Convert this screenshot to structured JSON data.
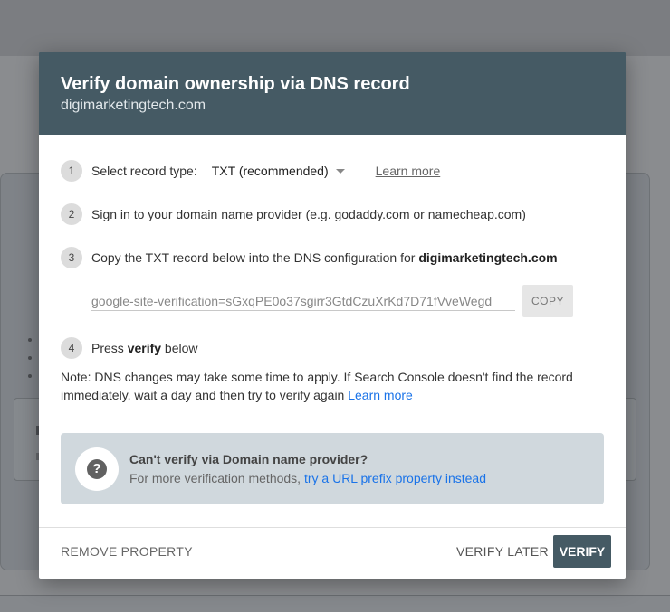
{
  "dialog": {
    "title": "Verify domain ownership via DNS record",
    "subtitle": "digimarketingtech.com"
  },
  "steps": [
    {
      "number": "1",
      "label": "Select record type:",
      "select_value": "TXT (recommended)",
      "learn_more": "Learn more"
    },
    {
      "number": "2",
      "label": "Sign in to your domain name provider (e.g. godaddy.com or namecheap.com)"
    },
    {
      "number": "3",
      "label": "Copy the TXT record below into the DNS configuration for ",
      "domain": "digimarketingtech.com",
      "record_value": "google-site-verification=sGxqPE0o37sgirr3GtdCzuXrKd7D71fVveWegd",
      "copy_label": "COPY"
    },
    {
      "number": "4",
      "label_prefix": "Press ",
      "label_bold": "verify",
      "label_suffix": " below"
    }
  ],
  "note": {
    "text": "Note: DNS changes may take some time to apply. If Search Console doesn't find the record immediately, wait a day and then try to verify again ",
    "link": "Learn more"
  },
  "info_box": {
    "icon": "question-mark-icon",
    "title": "Can't verify via Domain name provider?",
    "desc_prefix": "For more verification methods, ",
    "desc_link": "try a URL prefix property instead"
  },
  "footer": {
    "remove_label": "REMOVE PROPERTY",
    "later_label": "VERIFY LATER",
    "verify_label": "VERIFY"
  },
  "colors": {
    "header_bg": "#455a64",
    "link": "#1a73e8",
    "info_bg": "#d0d8dd"
  }
}
